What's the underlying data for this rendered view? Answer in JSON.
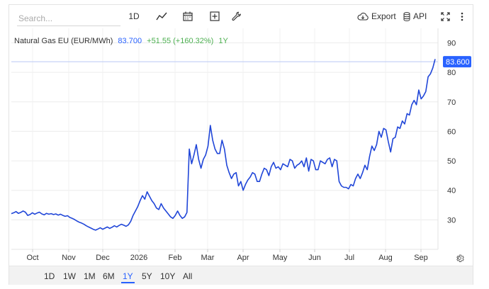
{
  "toolbar": {
    "search_placeholder": "Search...",
    "interval_label": "1D",
    "export_label": "Export",
    "api_label": "API",
    "icons": [
      "line-chart-icon",
      "calendar-icon",
      "plus-box-icon",
      "wrench-icon",
      "cloud-download-icon",
      "database-icon",
      "fullscreen-icon",
      "more-vertical-icon"
    ]
  },
  "header": {
    "name": "Natural Gas EU (EUR/MWh)",
    "price": "83.700",
    "change": "+51.55 (+160.32%)",
    "period": "1Y"
  },
  "ranges": [
    "1D",
    "1W",
    "1M",
    "6M",
    "1Y",
    "5Y",
    "10Y",
    "All"
  ],
  "active_range": "1Y",
  "colors": {
    "line": "#2046d8",
    "accent": "#2962ff",
    "positive": "#4caf50",
    "price_label": "#2962ff"
  },
  "chart_data": {
    "type": "line",
    "title": "Natural Gas EU (EUR/MWh)",
    "x_tick_labels": [
      "Oct",
      "Nov",
      "Dec",
      "2026",
      "Feb",
      "Mar",
      "Apr",
      "May",
      "Jun",
      "Jul",
      "Aug",
      "Sep"
    ],
    "y_ticks": [
      30,
      40,
      50,
      60,
      70,
      80,
      90
    ],
    "ylim": [
      20,
      93
    ],
    "last_value_label": "83.600",
    "last_value": 83.6,
    "grid": true,
    "series": [
      {
        "values": [
          32.1,
          32.4,
          32.8,
          32.2,
          32.5,
          33.0,
          32.6,
          31.5,
          31.8,
          32.4,
          31.9,
          32.3,
          32.6,
          32.0,
          31.7,
          32.2,
          31.9,
          32.1,
          31.8,
          32.0,
          31.6,
          31.9,
          31.5,
          31.2,
          31.4,
          30.8,
          30.5,
          30.1,
          29.6,
          29.2,
          28.9,
          28.5,
          28.0,
          27.6,
          27.2,
          26.8,
          26.5,
          26.9,
          27.3,
          26.8,
          27.2,
          27.6,
          27.1,
          27.5,
          28.0,
          27.6,
          28.1,
          28.5,
          28.2,
          27.8,
          28.3,
          29.5,
          31.5,
          33.0,
          34.5,
          36.5,
          38.2,
          37.0,
          39.5,
          38.0,
          36.5,
          35.5,
          34.0,
          33.5,
          35.5,
          34.0,
          33.0,
          32.0,
          31.0,
          30.5,
          31.5,
          33.0,
          31.5,
          30.5,
          31.0,
          32.5,
          54.0,
          49.0,
          52.0,
          55.5,
          50.5,
          47.5,
          50.5,
          52.0,
          55.0,
          62.0,
          57.0,
          54.0,
          52.5,
          52.5,
          57.0,
          54.0,
          48.5,
          46.0,
          44.0,
          45.5,
          46.0,
          41.5,
          43.0,
          40.0,
          42.0,
          43.5,
          44.5,
          46.0,
          45.5,
          43.0,
          43.0,
          45.5,
          47.5,
          47.0,
          45.0,
          48.0,
          49.5,
          47.5,
          48.0,
          47.0,
          49.0,
          48.5,
          48.0,
          50.5,
          50.0,
          47.5,
          48.5,
          49.0,
          50.0,
          48.0,
          51.0,
          46.5,
          50.5,
          50.0,
          47.0,
          47.0,
          50.0,
          49.5,
          49.0,
          50.5,
          51.0,
          48.0,
          50.5,
          50.0,
          43.0,
          41.5,
          41.0,
          41.0,
          40.5,
          42.0,
          41.5,
          44.0,
          45.5,
          44.0,
          46.0,
          48.5,
          47.0,
          51.5,
          55.0,
          53.5,
          55.5,
          60.0,
          58.0,
          61.0,
          60.5,
          56.5,
          53.0,
          57.5,
          58.0,
          61.5,
          61.0,
          63.5,
          62.5,
          66.0,
          65.5,
          69.0,
          70.5,
          69.0,
          74.0,
          71.0,
          72.0,
          73.5,
          78.5,
          79.5,
          81.5,
          84.5
        ]
      }
    ]
  }
}
